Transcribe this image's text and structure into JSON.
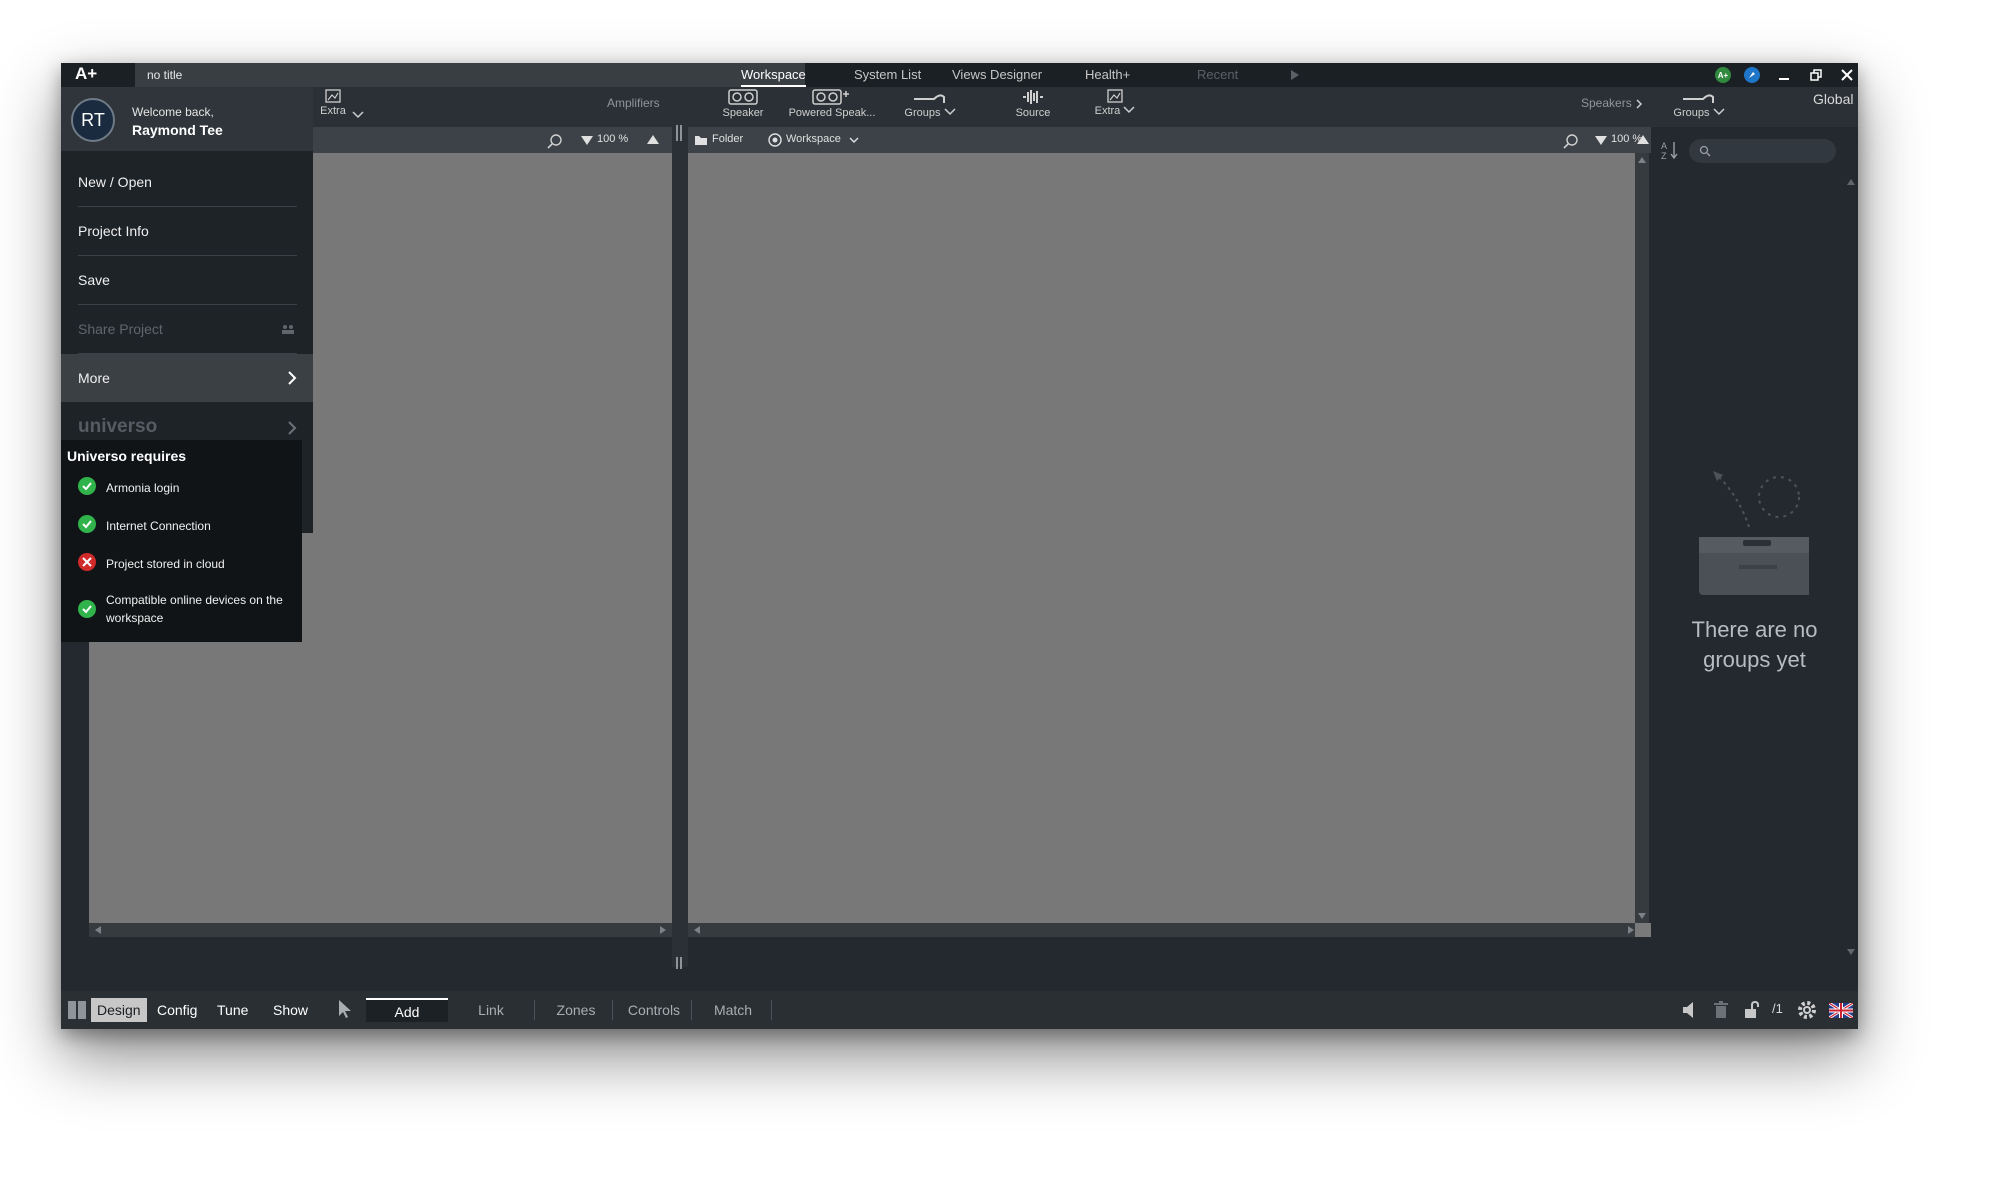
{
  "app": {
    "logo": "A+",
    "doc_title": "no title"
  },
  "nav": {
    "tabs": [
      {
        "label": "Workspace",
        "state": "active"
      },
      {
        "label": "System List",
        "state": "normal"
      },
      {
        "label": "Views Designer",
        "state": "normal"
      },
      {
        "label": "Health+",
        "state": "normal"
      },
      {
        "label": "Recent",
        "state": "disabled"
      }
    ]
  },
  "left_toolbar": {
    "extra_label": "Extra",
    "amplifiers_label": "Amplifiers"
  },
  "center_toolbar": {
    "tools": [
      {
        "label": "Speaker",
        "icon": "speaker-icon"
      },
      {
        "label": "Powered Speak...",
        "icon": "powered-speaker-icon"
      },
      {
        "label": "Groups",
        "icon": "groups-icon"
      },
      {
        "label": "Source",
        "icon": "source-icon"
      },
      {
        "label": "Extra",
        "icon": "extra-icon"
      }
    ],
    "speakers_label": "Speakers",
    "groups_label": "Groups",
    "global_label": "Global"
  },
  "left_panel": {
    "zoom": "100 %"
  },
  "workspace_panel": {
    "folder_label": "Folder",
    "workspace_label": "Workspace",
    "zoom": "100 %"
  },
  "groups_panel": {
    "empty_line1": "There are no",
    "empty_line2": "groups yet"
  },
  "side_menu": {
    "avatar_initials": "RT",
    "welcome": "Welcome back,",
    "user_name": "Raymond Tee",
    "items": [
      {
        "label": "New / Open",
        "state": "normal"
      },
      {
        "label": "Project Info",
        "state": "normal"
      },
      {
        "label": "Save",
        "state": "normal"
      },
      {
        "label": "Share Project",
        "state": "disabled"
      },
      {
        "label": "More",
        "state": "hover"
      }
    ],
    "universo_label": "universo"
  },
  "universo_requires": {
    "title": "Universo requires",
    "items": [
      {
        "label": "Armonia login",
        "status": "ok"
      },
      {
        "label": "Internet Connection",
        "status": "ok"
      },
      {
        "label": "Project stored in cloud",
        "status": "fail"
      },
      {
        "label": "Compatible online devices on the workspace",
        "status": "ok"
      }
    ]
  },
  "bottom_bar": {
    "modes": [
      "Design",
      "Config",
      "Tune",
      "Show"
    ],
    "active_mode": "Design",
    "tabs": [
      "Add",
      "Link",
      "Zones",
      "Controls",
      "Match"
    ],
    "active_tab": "Add",
    "page_indicator": "/1"
  },
  "colors": {
    "canvas": "#787878",
    "ok_green": "#2fb34a",
    "fail_red": "#d02a2a"
  }
}
